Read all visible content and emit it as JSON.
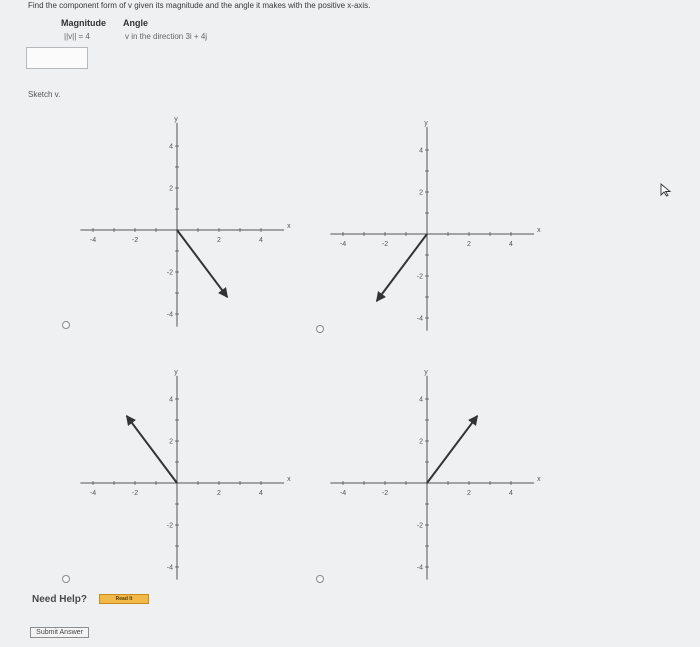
{
  "question": "Find the component form of v given its magnitude and the angle it makes with the positive x-axis.",
  "magnitude": {
    "header": "Magnitude",
    "value": "||v|| = 4"
  },
  "angle": {
    "header": "Angle",
    "value": "v in the direction 3i + 4j"
  },
  "answer_value": "",
  "sketch_label": "Sketch v.",
  "graphs": [
    {
      "option": "A",
      "x_ticks": [
        "-4",
        "-2",
        "2",
        "4"
      ],
      "y_ticks": [
        "4",
        "2",
        "-2",
        "-4"
      ],
      "x_label": "x",
      "y_label": "y",
      "vector": {
        "from": [
          0,
          0
        ],
        "to": [
          2.4,
          -3.2
        ]
      }
    },
    {
      "option": "B",
      "x_ticks": [
        "-4",
        "-2",
        "2",
        "4"
      ],
      "y_ticks": [
        "4",
        "2",
        "-2",
        "-4"
      ],
      "x_label": "x",
      "y_label": "y",
      "vector": {
        "from": [
          0,
          0
        ],
        "to": [
          -2.4,
          -3.2
        ]
      }
    },
    {
      "option": "C",
      "x_ticks": [
        "-4",
        "-2",
        "2",
        "4"
      ],
      "y_ticks": [
        "4",
        "2",
        "-2",
        "-4"
      ],
      "x_label": "x",
      "y_label": "y",
      "vector": {
        "from": [
          0,
          0
        ],
        "to": [
          -2.4,
          3.2
        ]
      }
    },
    {
      "option": "D",
      "x_ticks": [
        "-4",
        "-2",
        "2",
        "4"
      ],
      "y_ticks": [
        "4",
        "2",
        "-2",
        "-4"
      ],
      "x_label": "x",
      "y_label": "y",
      "vector": {
        "from": [
          0,
          0
        ],
        "to": [
          2.4,
          3.2
        ]
      }
    }
  ],
  "need_help": "Need Help?",
  "read_it": "Read It",
  "submit": "Submit Answer",
  "colors": {
    "background": "#eef0f1",
    "axis": "#555555",
    "vector": "#333333",
    "read_it": "#f0b94a"
  },
  "icons": {
    "cursor": "mouse-pointer-icon"
  }
}
